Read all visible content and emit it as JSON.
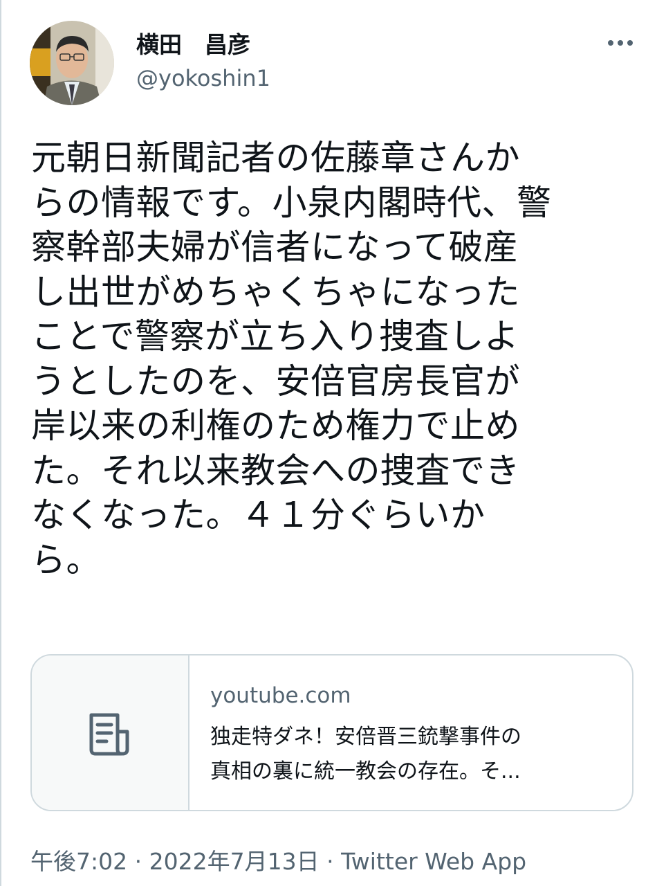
{
  "author": {
    "display_name": "横田　昌彦",
    "handle": "@yokoshin1"
  },
  "more_icon": "more-horizontal-icon",
  "tweet": {
    "lines": [
      "元朝日新聞記者の佐藤章さんか",
      "らの情報です。小泉内閣時代、警",
      "察幹部夫婦が信者になって破産",
      "し出世がめちゃくちゃになった",
      "ことで警察が立ち入り捜査しよ",
      "うとしたのを、安倍官房長官が",
      "岸以来の利権のため権力で止め",
      "た。それ以来教会への捜査でき",
      "なくなった。４１分ぐらいか",
      "ら。"
    ]
  },
  "link_card": {
    "icon": "document-icon",
    "domain": "youtube.com",
    "title_lines": [
      "独走特ダネ！安倍晋三銃撃事件の",
      "真相の裏に統一教会の存在。そ..."
    ]
  },
  "meta": {
    "time": "午後7:02",
    "separator": "·",
    "date": "2022年7月13日",
    "source": "Twitter Web App"
  },
  "colors": {
    "text": "#0f1419",
    "secondary": "#536471",
    "border": "#cfd9de"
  }
}
